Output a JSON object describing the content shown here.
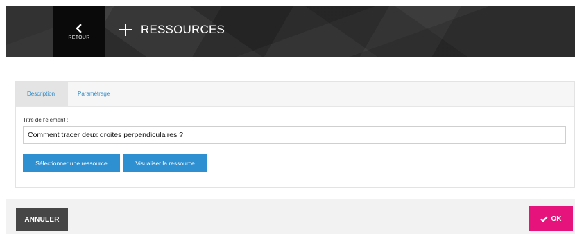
{
  "header": {
    "back_label": "RETOUR",
    "title": "RESSOURCES",
    "icons": {
      "back": "chevron-left-icon",
      "add": "plus-icon"
    }
  },
  "tabs": [
    {
      "label": "Description",
      "active": true
    },
    {
      "label": "Paramétrage",
      "active": false
    }
  ],
  "form": {
    "title_label": "Titre de l'élément :",
    "title_value": "Comment tracer deux droites perpendiculaires ?",
    "select_button": "Sélectionner une ressource",
    "view_button": "Visualiser la ressource"
  },
  "footer": {
    "cancel_label": "ANNULER",
    "ok_label": "OK",
    "ok_icon": "check-icon"
  },
  "colors": {
    "accent_blue": "#2e8fd1",
    "ok_pink": "#e6137c",
    "header_dark": "#2c2c2c",
    "cancel_gray": "#464646"
  }
}
